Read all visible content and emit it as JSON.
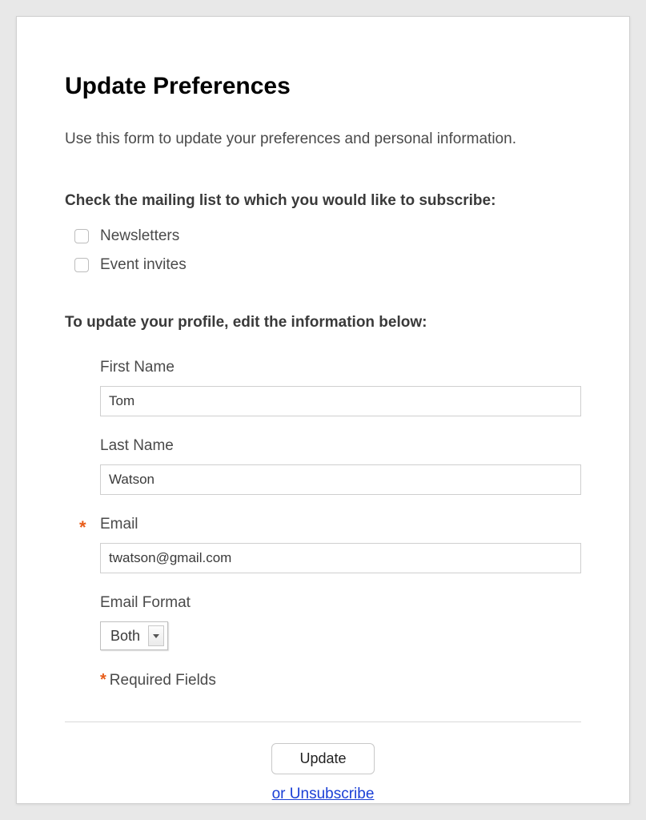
{
  "page_title": "Update Preferences",
  "intro_text": "Use this form to update your preferences and personal information.",
  "mailing": {
    "heading": "Check the mailing list to which you would like to subscribe:",
    "options": [
      {
        "label": "Newsletters",
        "checked": false
      },
      {
        "label": "Event invites",
        "checked": false
      }
    ]
  },
  "profile": {
    "heading": "To update your profile, edit the information below:",
    "fields": {
      "first_name": {
        "label": "First Name",
        "value": "Tom",
        "required": false
      },
      "last_name": {
        "label": "Last Name",
        "value": "Watson",
        "required": false
      },
      "email": {
        "label": "Email",
        "value": "twatson@gmail.com",
        "required": true
      },
      "email_format": {
        "label": "Email Format",
        "value": "Both"
      }
    },
    "required_note": "Required Fields"
  },
  "actions": {
    "update_label": "Update",
    "unsubscribe_label": "or Unsubscribe"
  }
}
